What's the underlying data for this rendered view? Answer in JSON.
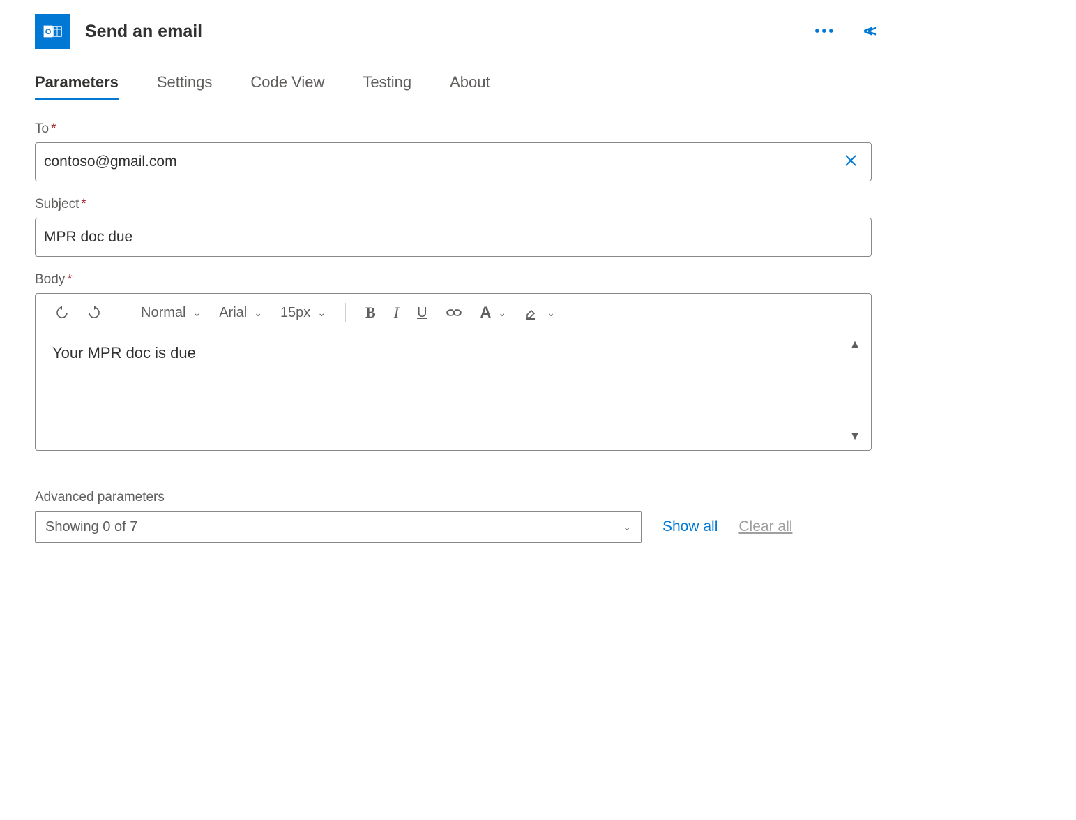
{
  "header": {
    "title": "Send an email"
  },
  "tabs": {
    "items": [
      "Parameters",
      "Settings",
      "Code View",
      "Testing",
      "About"
    ],
    "active_index": 0
  },
  "fields": {
    "to": {
      "label": "To",
      "value": "contoso@gmail.com"
    },
    "subject": {
      "label": "Subject",
      "value": "MPR doc due"
    },
    "body": {
      "label": "Body",
      "value": "Your MPR doc is due",
      "toolbar": {
        "style": "Normal",
        "font": "Arial",
        "size": "15px"
      }
    }
  },
  "advanced": {
    "label": "Advanced parameters",
    "selected_text": "Showing 0 of 7",
    "show_all": "Show all",
    "clear_all": "Clear all"
  }
}
